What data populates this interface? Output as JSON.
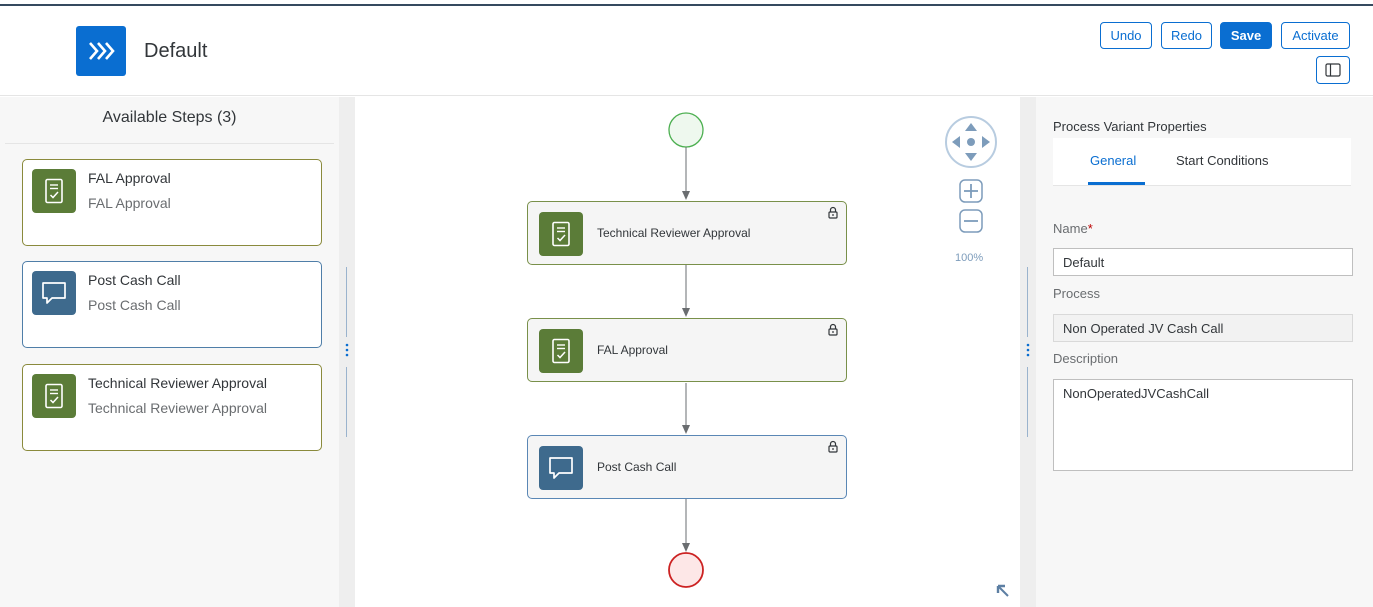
{
  "header": {
    "title": "Default",
    "undo_label": "Undo",
    "redo_label": "Redo",
    "save_label": "Save",
    "activate_label": "Activate"
  },
  "left_panel": {
    "title": "Available Steps (3)",
    "steps": [
      {
        "title": "FAL Approval",
        "subtitle": "FAL Approval",
        "icon": "approval-document-icon"
      },
      {
        "title": "Post Cash Call",
        "subtitle": "Post Cash Call",
        "icon": "message-bubble-icon"
      },
      {
        "title": "Technical Reviewer Approval",
        "subtitle": "Technical Reviewer Approval",
        "icon": "approval-document-icon"
      }
    ]
  },
  "canvas": {
    "nodes": [
      {
        "label": "Technical Reviewer Approval",
        "icon": "approval-document-icon"
      },
      {
        "label": "FAL Approval",
        "icon": "approval-document-icon"
      },
      {
        "label": "Post Cash Call",
        "icon": "message-bubble-icon"
      }
    ],
    "zoom_level": "100%"
  },
  "right_panel": {
    "title": "Process Variant Properties",
    "tabs": [
      "General",
      "Start Conditions"
    ],
    "name_label": "Name",
    "name_required": "*",
    "name_value": "Default",
    "process_label": "Process",
    "process_value": "Non Operated JV Cash Call",
    "description_label": "Description",
    "description_value": "NonOperatedJVCashCall"
  },
  "colors": {
    "accent": "#0a6ed1",
    "approval_green": "#5b7c38",
    "message_blue": "#3e6a8d",
    "start_event": "#4caf50",
    "end_event": "#cc2222"
  }
}
